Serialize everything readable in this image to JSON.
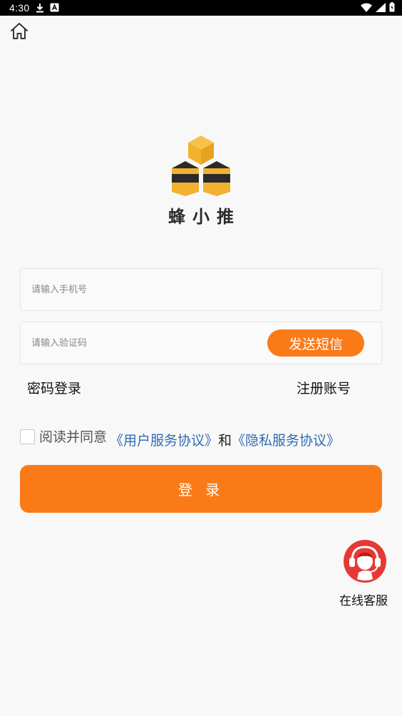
{
  "status_bar": {
    "time": "4:30"
  },
  "brand": {
    "name": "蜂小推",
    "colors": {
      "yellow": "#f2b12f",
      "dark": "#2b2b2b"
    }
  },
  "phone_input": {
    "placeholder": "请输入手机号",
    "value": ""
  },
  "code_input": {
    "placeholder": "请输入验证码",
    "value": ""
  },
  "send_sms_label": "发送短信",
  "password_login_label": "密码登录",
  "register_label": "注册账号",
  "agreement": {
    "prefix": "阅读并同意",
    "user_agreement": "《用户服务协议》",
    "and": "和",
    "privacy_agreement": "《隐私服务协议》",
    "checked": false
  },
  "login_label": "登 录",
  "customer_service_label": "在线客服",
  "theme": {
    "accent": "#fb7a18",
    "link": "#2f6db5",
    "background": "#f8f8f8"
  }
}
